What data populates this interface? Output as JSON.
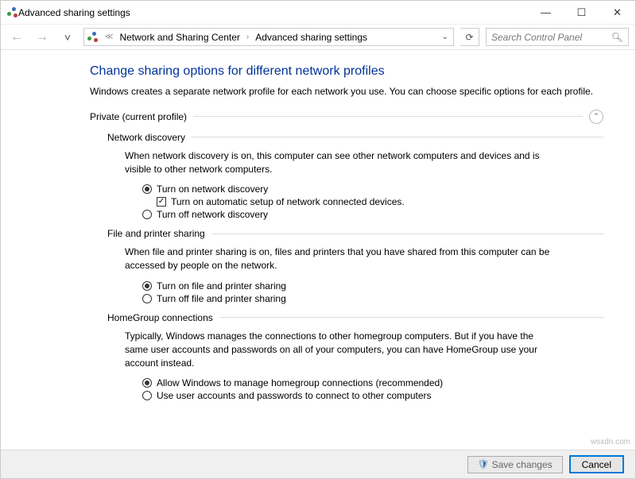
{
  "window": {
    "title": "Advanced sharing settings"
  },
  "nav": {
    "crumb1": "Network and Sharing Center",
    "crumb2": "Advanced sharing settings"
  },
  "search": {
    "placeholder": "Search Control Panel"
  },
  "page": {
    "heading": "Change sharing options for different network profiles",
    "subtext": "Windows creates a separate network profile for each network you use. You can choose specific options for each profile."
  },
  "private": {
    "label": "Private (current profile)",
    "netdisc": {
      "label": "Network discovery",
      "desc": "When network discovery is on, this computer can see other network computers and devices and is visible to other network computers.",
      "on": "Turn on network discovery",
      "auto": "Turn on automatic setup of network connected devices.",
      "off": "Turn off network discovery"
    },
    "fps": {
      "label": "File and printer sharing",
      "desc": "When file and printer sharing is on, files and printers that you have shared from this computer can be accessed by people on the network.",
      "on": "Turn on file and printer sharing",
      "off": "Turn off file and printer sharing"
    },
    "hg": {
      "label": "HomeGroup connections",
      "desc": "Typically, Windows manages the connections to other homegroup computers. But if you have the same user accounts and passwords on all of your computers, you can have HomeGroup use your account instead.",
      "allow": "Allow Windows to manage homegroup connections (recommended)",
      "use": "Use user accounts and passwords to connect to other computers"
    }
  },
  "footer": {
    "save": "Save changes",
    "cancel": "Cancel"
  },
  "watermark": "wsxdn.com"
}
